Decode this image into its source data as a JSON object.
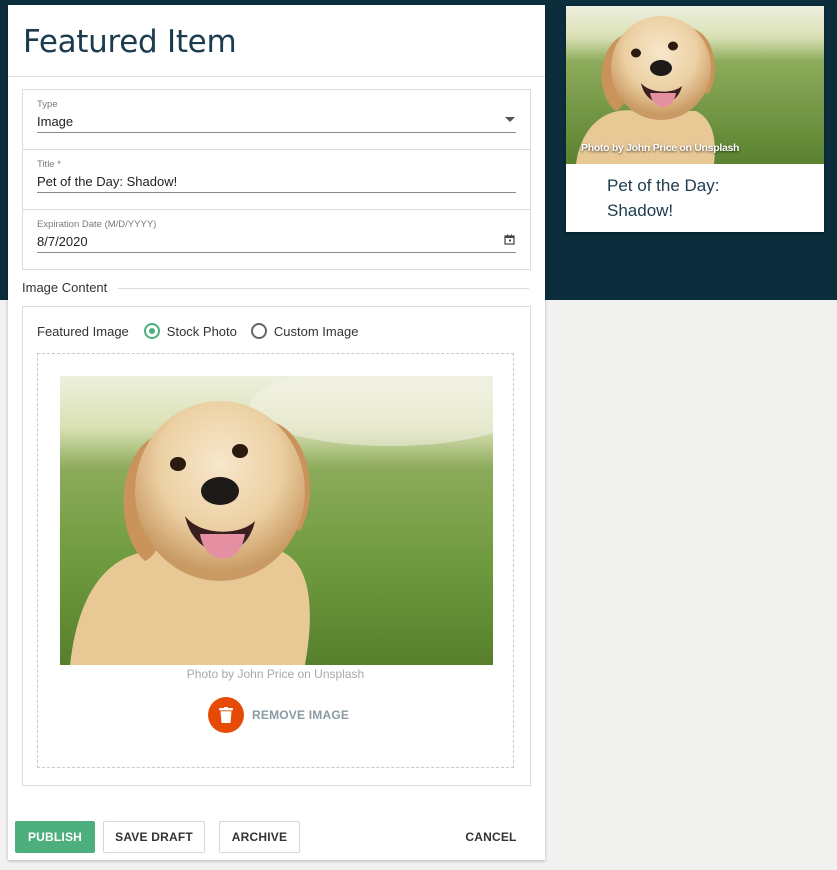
{
  "editor": {
    "title": "Featured Item",
    "fields": {
      "type": {
        "label": "Type",
        "value": "Image"
      },
      "title": {
        "label": "Title *",
        "value": "Pet of the Day: Shadow!"
      },
      "expiration": {
        "label": "Expiration Date (M/D/YYYY)",
        "value": "8/7/2020"
      }
    },
    "image_section": {
      "legend": "Image Content",
      "featured_image_label": "Featured Image",
      "options": [
        {
          "label": "Stock Photo",
          "selected": true
        },
        {
          "label": "Custom Image",
          "selected": false
        }
      ],
      "photo_caption": "Photo by John Price on Unsplash",
      "remove_label": "REMOVE IMAGE"
    },
    "actions": {
      "publish": "PUBLISH",
      "save_draft": "SAVE DRAFT",
      "archive": "ARCHIVE",
      "cancel": "CANCEL"
    }
  },
  "preview": {
    "credit": "Photo by John Price on Unsplash",
    "title": "Pet of the Day: Shadow!"
  },
  "colors": {
    "header_band": "#0b2d3c",
    "accent_green": "#4caf7d",
    "remove_orange": "#e64a07",
    "title_text": "#1b3b4e"
  },
  "icons": {
    "type_dropdown": "caret-down-icon",
    "date_picker": "calendar-icon",
    "remove": "trash-icon"
  }
}
